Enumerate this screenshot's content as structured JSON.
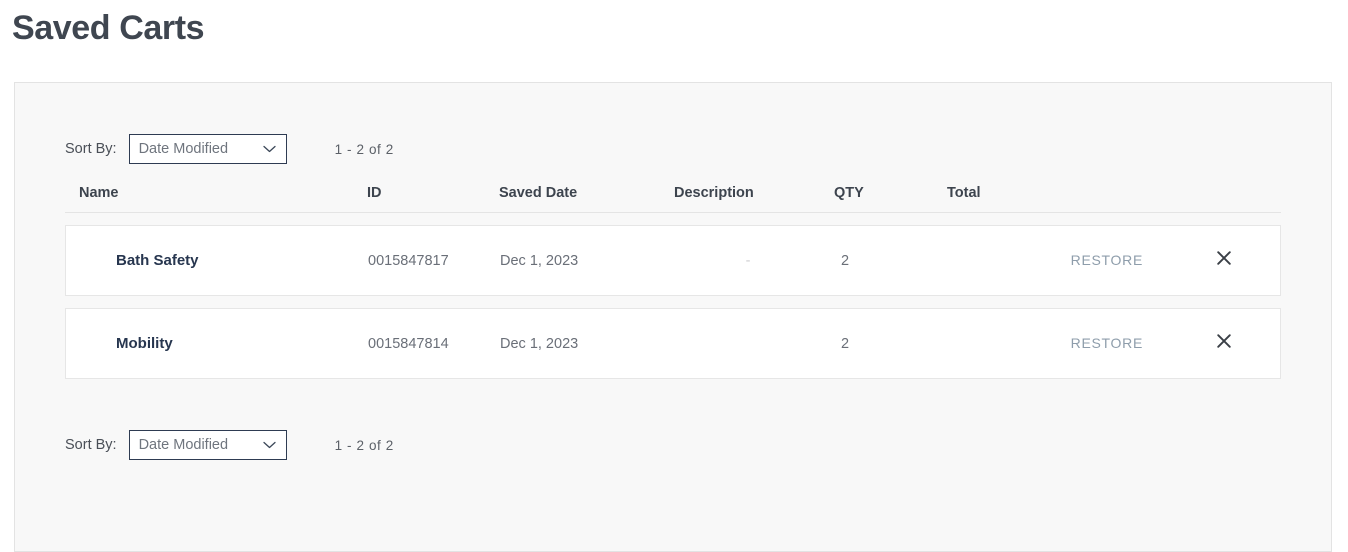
{
  "page_title": "Saved Carts",
  "sort_bar": {
    "label": "Sort By:",
    "selected_option": "Date Modified",
    "options": [
      "Date Modified"
    ],
    "pagination": "1 - 2  of  2"
  },
  "table": {
    "headers": {
      "name": "Name",
      "id": "ID",
      "saved_date": "Saved Date",
      "description": "Description",
      "qty": "QTY",
      "total": "Total"
    },
    "rows": [
      {
        "name": "Bath Safety",
        "id": "0015847817",
        "saved_date": "Dec 1, 2023",
        "description": "-",
        "qty": "2",
        "total": "",
        "restore_label": "RESTORE",
        "remove_icon": "close-icon"
      },
      {
        "name": "Mobility",
        "id": "0015847814",
        "saved_date": "Dec 1, 2023",
        "description": "",
        "qty": "2",
        "total": "",
        "restore_label": "RESTORE",
        "remove_icon": "close-icon"
      }
    ]
  },
  "colors": {
    "title": "#3f4650",
    "panel_bg": "#f8f8f8",
    "row_bg": "#ffffff",
    "select_border": "#2e3b52",
    "restore_link": "#8e9dab",
    "name_text": "#27364f"
  },
  "icons": {
    "chevron_down": "chevron-down-icon",
    "close": "close-icon"
  }
}
